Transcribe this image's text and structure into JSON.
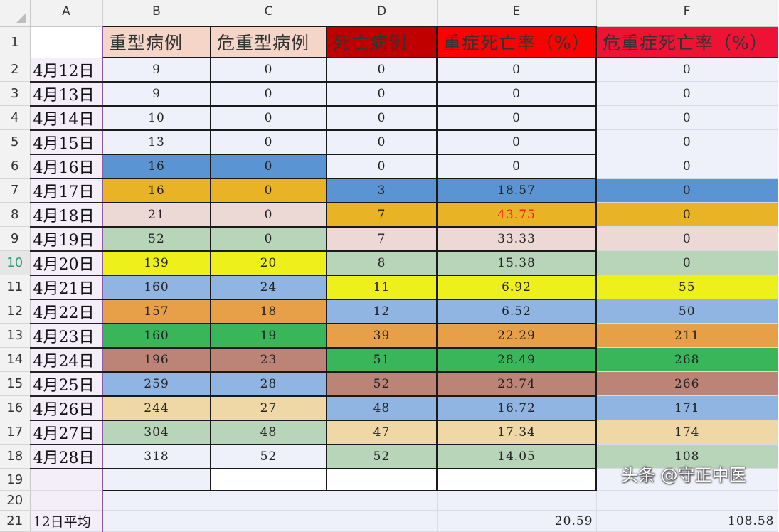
{
  "columns": [
    "A",
    "B",
    "C",
    "D",
    "E",
    "F"
  ],
  "row_numbers": [
    "1",
    "2",
    "3",
    "4",
    "5",
    "6",
    "7",
    "8",
    "9",
    "10",
    "11",
    "12",
    "13",
    "14",
    "15",
    "16",
    "17",
    "18",
    "19",
    "20",
    "21"
  ],
  "selected_row": "10",
  "headers": {
    "b": "重型病例",
    "c": "危重型病例",
    "d": "死亡病例",
    "e": "重症死亡率（%）",
    "f": "危重症死亡率（%）"
  },
  "header_colors": {
    "b": "#f4d5c8",
    "c": "#f4d5c8",
    "d": "#c00000",
    "e": "#ff0000",
    "f": "#ee1234"
  },
  "rows": [
    {
      "date": "4月12日",
      "b": "9",
      "c": "0",
      "d": "0",
      "e": "0",
      "f": "0"
    },
    {
      "date": "4月13日",
      "b": "9",
      "c": "0",
      "d": "0",
      "e": "0",
      "f": "0"
    },
    {
      "date": "4月14日",
      "b": "10",
      "c": "0",
      "d": "0",
      "e": "0",
      "f": "0"
    },
    {
      "date": "4月15日",
      "b": "13",
      "c": "0",
      "d": "0",
      "e": "0",
      "f": "0"
    },
    {
      "date": "4月16日",
      "b": "16",
      "c": "0",
      "d": "0",
      "e": "0",
      "f": "0"
    },
    {
      "date": "4月17日",
      "b": "16",
      "c": "0",
      "d": "3",
      "e": "18.57",
      "f": "0"
    },
    {
      "date": "4月18日",
      "b": "21",
      "c": "0",
      "d": "7",
      "e": "43.75",
      "f": "0"
    },
    {
      "date": "4月19日",
      "b": "52",
      "c": "0",
      "d": "7",
      "e": "33.33",
      "f": "0"
    },
    {
      "date": "4月20日",
      "b": "139",
      "c": "20",
      "d": "8",
      "e": "15.38",
      "f": "0"
    },
    {
      "date": "4月21日",
      "b": "160",
      "c": "24",
      "d": "11",
      "e": "6.92",
      "f": "55"
    },
    {
      "date": "4月22日",
      "b": "157",
      "c": "18",
      "d": "12",
      "e": "6.52",
      "f": "50"
    },
    {
      "date": "4月23日",
      "b": "160",
      "c": "19",
      "d": "39",
      "e": "22.29",
      "f": "211"
    },
    {
      "date": "4月24日",
      "b": "196",
      "c": "23",
      "d": "51",
      "e": "28.49",
      "f": "268"
    },
    {
      "date": "4月25日",
      "b": "259",
      "c": "28",
      "d": "52",
      "e": "23.74",
      "f": "266"
    },
    {
      "date": "4月26日",
      "b": "244",
      "c": "27",
      "d": "48",
      "e": "16.72",
      "f": "171"
    },
    {
      "date": "4月27日",
      "b": "304",
      "c": "48",
      "d": "47",
      "e": "17.34",
      "f": "174"
    },
    {
      "date": "4月28日",
      "b": "318",
      "c": "52",
      "d": "52",
      "e": "14.05",
      "f": "108"
    }
  ],
  "cell_colors": [
    {
      "b": "#eef0fa",
      "c": "#eef0fa",
      "d": "#eef0fa",
      "e": "#eef0fa",
      "f": "#eef0fa"
    },
    {
      "b": "#eef0fa",
      "c": "#eef0fa",
      "d": "#eef0fa",
      "e": "#eef0fa",
      "f": "#eef0fa"
    },
    {
      "b": "#eef0fa",
      "c": "#eef0fa",
      "d": "#eef0fa",
      "e": "#eef0fa",
      "f": "#eef0fa"
    },
    {
      "b": "#eef0fa",
      "c": "#eef0fa",
      "d": "#eef0fa",
      "e": "#eef0fa",
      "f": "#eef0fa"
    },
    {
      "b": "#5b94d2",
      "c": "#5b94d2",
      "d": "#eef0fa",
      "e": "#eef0fa",
      "f": "#eef0fa"
    },
    {
      "b": "#e8b324",
      "c": "#e8b324",
      "d": "#5b94d2",
      "e": "#5b94d2",
      "f": "#5b94d2"
    },
    {
      "b": "#ecd9d6",
      "c": "#ecd9d6",
      "d": "#e8b324",
      "e": "#e8b324",
      "f": "#e8b324"
    },
    {
      "b": "#b9d5b9",
      "c": "#b9d5b9",
      "d": "#ecd9d6",
      "e": "#ecd9d6",
      "f": "#ecd9d6"
    },
    {
      "b": "#eef01c",
      "c": "#eef01c",
      "d": "#b9d5b9",
      "e": "#b9d5b9",
      "f": "#b9d5b9"
    },
    {
      "b": "#90b5e3",
      "c": "#90b5e3",
      "d": "#eef01c",
      "e": "#eef01c",
      "f": "#eef01c"
    },
    {
      "b": "#e8a048",
      "c": "#e8a048",
      "d": "#90b5e3",
      "e": "#90b5e3",
      "f": "#90b5e3"
    },
    {
      "b": "#39b55a",
      "c": "#39b55a",
      "d": "#e8a048",
      "e": "#e8a048",
      "f": "#e8a048"
    },
    {
      "b": "#bb8476",
      "c": "#bb8476",
      "d": "#39b55a",
      "e": "#39b55a",
      "f": "#39b55a"
    },
    {
      "b": "#90b5e3",
      "c": "#90b5e3",
      "d": "#bb8476",
      "e": "#bb8476",
      "f": "#bb8476"
    },
    {
      "b": "#efd8a6",
      "c": "#efd8a6",
      "d": "#90b5e3",
      "e": "#90b5e3",
      "f": "#90b5e3"
    },
    {
      "b": "#b9d5b9",
      "c": "#b9d5b9",
      "d": "#efd8a6",
      "e": "#efd8a6",
      "f": "#efd8a6"
    },
    {
      "b": "#eef0fa",
      "c": "#eef0fa",
      "d": "#b9d5b9",
      "e": "#b9d5b9",
      "f": "#b9d5b9"
    }
  ],
  "highlight_text_color": "#ff1a1a",
  "highlight_cell": "4月18日 E",
  "summary": {
    "label": "12日平均",
    "e_avg": "20.59",
    "f_avg": "108.58"
  },
  "watermark": "头条 @守正中医"
}
